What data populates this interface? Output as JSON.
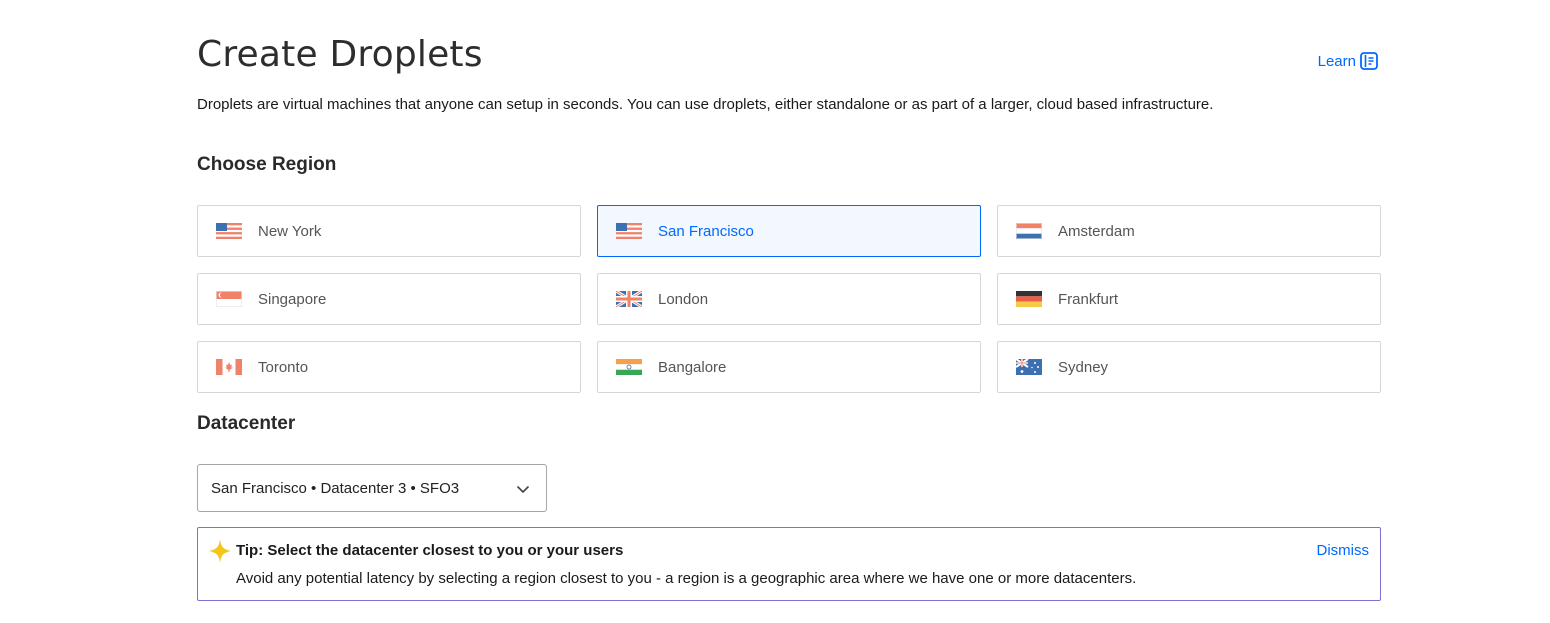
{
  "header": {
    "title": "Create Droplets",
    "learn_label": "Learn",
    "description": "Droplets are virtual machines that anyone can setup in seconds. You can use droplets, either standalone or as part of a larger, cloud based infrastructure."
  },
  "region": {
    "title": "Choose Region",
    "selected": "San Francisco",
    "items": [
      {
        "label": "New York",
        "flag": "us-flag"
      },
      {
        "label": "San Francisco",
        "flag": "us-flag"
      },
      {
        "label": "Amsterdam",
        "flag": "nl-flag"
      },
      {
        "label": "Singapore",
        "flag": "sg-flag"
      },
      {
        "label": "London",
        "flag": "uk-flag"
      },
      {
        "label": "Frankfurt",
        "flag": "de-flag"
      },
      {
        "label": "Toronto",
        "flag": "ca-flag"
      },
      {
        "label": "Bangalore",
        "flag": "in-flag"
      },
      {
        "label": "Sydney",
        "flag": "au-flag"
      }
    ]
  },
  "datacenter": {
    "title": "Datacenter",
    "selected_value": "San Francisco • Datacenter 3 • SFO3"
  },
  "tip": {
    "title": "Tip: Select the datacenter closest to you or your users",
    "body": "Avoid any potential latency by selecting a region closest to you - a region is a geographic area where we have one or more datacenters.",
    "dismiss_label": "Dismiss"
  },
  "colors": {
    "accent": "#0069ff",
    "tip_border": "#7f6fd6",
    "tip_star": "#f5c518"
  }
}
